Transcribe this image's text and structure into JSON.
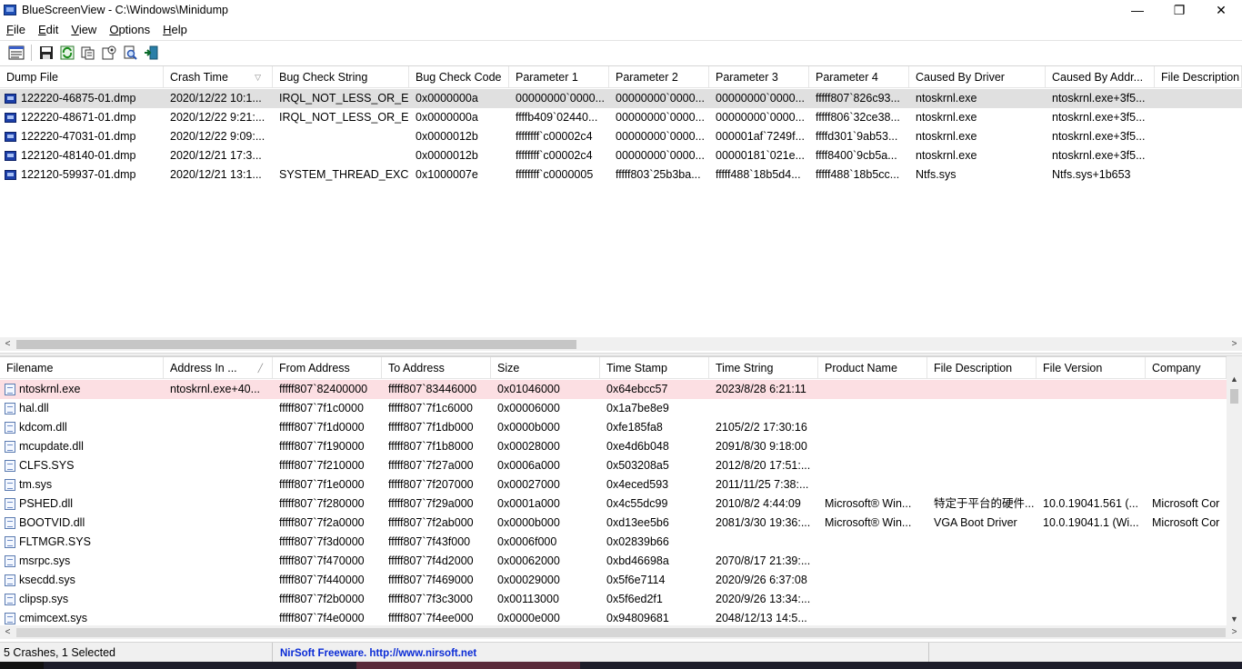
{
  "window": {
    "title": "BlueScreenView  -  C:\\Windows\\Minidump",
    "controls": {
      "minimize": "—",
      "maximize": "❐",
      "close": "✕"
    }
  },
  "menu": [
    {
      "accel": "F",
      "rest": "ile"
    },
    {
      "accel": "E",
      "rest": "dit"
    },
    {
      "accel": "V",
      "rest": "iew"
    },
    {
      "accel": "O",
      "rest": "ptions"
    },
    {
      "accel": "H",
      "rest": "elp"
    }
  ],
  "toolbar": {
    "icons": [
      "properties-icon",
      "save-icon",
      "refresh-icon",
      "copy-icon",
      "advanced-options-icon",
      "find-icon",
      "exit-icon"
    ]
  },
  "top_table": {
    "columns": [
      "Dump File",
      "Crash Time",
      "Bug Check String",
      "Bug Check Code",
      "Parameter 1",
      "Parameter 2",
      "Parameter 3",
      "Parameter 4",
      "Caused By Driver",
      "Caused By Addr...",
      "File Description"
    ],
    "sort_column": "Crash Time",
    "sort_glyph": "▽",
    "rows": [
      [
        "122220-46875-01.dmp",
        "2020/12/22 10:1...",
        "IRQL_NOT_LESS_OR_E...",
        "0x0000000a",
        "00000000`0000...",
        "00000000`0000...",
        "00000000`0000...",
        "fffff807`826c93...",
        "ntoskrnl.exe",
        "ntoskrnl.exe+3f5...",
        ""
      ],
      [
        "122220-48671-01.dmp",
        "2020/12/22 9:21:...",
        "IRQL_NOT_LESS_OR_E...",
        "0x0000000a",
        "ffffb409`02440...",
        "00000000`0000...",
        "00000000`0000...",
        "fffff806`32ce38...",
        "ntoskrnl.exe",
        "ntoskrnl.exe+3f5...",
        ""
      ],
      [
        "122220-47031-01.dmp",
        "2020/12/22 9:09:...",
        "",
        "0x0000012b",
        "ffffffff`c00002c4",
        "00000000`0000...",
        "000001af`7249f...",
        "ffffd301`9ab53...",
        "ntoskrnl.exe",
        "ntoskrnl.exe+3f5...",
        ""
      ],
      [
        "122120-48140-01.dmp",
        "2020/12/21 17:3...",
        "",
        "0x0000012b",
        "ffffffff`c00002c4",
        "00000000`0000...",
        "00000181`021e...",
        "ffff8400`9cb5a...",
        "ntoskrnl.exe",
        "ntoskrnl.exe+3f5...",
        ""
      ],
      [
        "122120-59937-01.dmp",
        "2020/12/21 13:1...",
        "SYSTEM_THREAD_EXC...",
        "0x1000007e",
        "ffffffff`c0000005",
        "fffff803`25b3ba...",
        "fffff488`18b5d4...",
        "fffff488`18b5cc...",
        "Ntfs.sys",
        "Ntfs.sys+1b653",
        ""
      ]
    ]
  },
  "bottom_table": {
    "columns": [
      "Filename",
      "Address In ...",
      "From Address",
      "To Address",
      "Size",
      "Time Stamp",
      "Time String",
      "Product Name",
      "File Description",
      "File Version",
      "Company"
    ],
    "sort_column": "Address In ...",
    "sort_glyph": "╱",
    "rows": [
      [
        "ntoskrnl.exe",
        "ntoskrnl.exe+40...",
        "fffff807`82400000",
        "fffff807`83446000",
        "0x01046000",
        "0x64ebcc57",
        "2023/8/28 6:21:11",
        "",
        "",
        "",
        ""
      ],
      [
        "hal.dll",
        "",
        "fffff807`7f1c0000",
        "fffff807`7f1c6000",
        "0x00006000",
        "0x1a7be8e9",
        "",
        "",
        "",
        "",
        ""
      ],
      [
        "kdcom.dll",
        "",
        "fffff807`7f1d0000",
        "fffff807`7f1db000",
        "0x0000b000",
        "0xfe185fa8",
        "2105/2/2 17:30:16",
        "",
        "",
        "",
        ""
      ],
      [
        "mcupdate.dll",
        "",
        "fffff807`7f190000",
        "fffff807`7f1b8000",
        "0x00028000",
        "0xe4d6b048",
        "2091/8/30 9:18:00",
        "",
        "",
        "",
        ""
      ],
      [
        "CLFS.SYS",
        "",
        "fffff807`7f210000",
        "fffff807`7f27a000",
        "0x0006a000",
        "0x503208a5",
        "2012/8/20 17:51:...",
        "",
        "",
        "",
        ""
      ],
      [
        "tm.sys",
        "",
        "fffff807`7f1e0000",
        "fffff807`7f207000",
        "0x00027000",
        "0x4eced593",
        "2011/11/25 7:38:...",
        "",
        "",
        "",
        ""
      ],
      [
        "PSHED.dll",
        "",
        "fffff807`7f280000",
        "fffff807`7f29a000",
        "0x0001a000",
        "0x4c55dc99",
        "2010/8/2 4:44:09",
        "Microsoft® Win...",
        "特定于平台的硬件...",
        "10.0.19041.561 (...",
        "Microsoft Cor"
      ],
      [
        "BOOTVID.dll",
        "",
        "fffff807`7f2a0000",
        "fffff807`7f2ab000",
        "0x0000b000",
        "0xd13ee5b6",
        "2081/3/30 19:36:...",
        "Microsoft® Win...",
        "VGA Boot Driver",
        "10.0.19041.1 (Wi...",
        "Microsoft Cor"
      ],
      [
        "FLTMGR.SYS",
        "",
        "fffff807`7f3d0000",
        "fffff807`7f43f000",
        "0x0006f000",
        "0x02839b66",
        "",
        "",
        "",
        "",
        ""
      ],
      [
        "msrpc.sys",
        "",
        "fffff807`7f470000",
        "fffff807`7f4d2000",
        "0x00062000",
        "0xbd46698a",
        "2070/8/17 21:39:...",
        "",
        "",
        "",
        ""
      ],
      [
        "ksecdd.sys",
        "",
        "fffff807`7f440000",
        "fffff807`7f469000",
        "0x00029000",
        "0x5f6e7114",
        "2020/9/26 6:37:08",
        "",
        "",
        "",
        ""
      ],
      [
        "clipsp.sys",
        "",
        "fffff807`7f2b0000",
        "fffff807`7f3c3000",
        "0x00113000",
        "0x5f6ed2f1",
        "2020/9/26 13:34:...",
        "",
        "",
        "",
        ""
      ],
      [
        "cmimcext.sys",
        "",
        "fffff807`7f4e0000",
        "fffff807`7f4ee000",
        "0x0000e000",
        "0x94809681",
        "2048/12/13 14:5...",
        "",
        "",
        "",
        ""
      ]
    ]
  },
  "status": {
    "summary": "5 Crashes, 1 Selected",
    "link": "NirSoft Freeware.  http://www.nirsoft.net"
  },
  "scroll_arrows": {
    "left": "<",
    "right": ">",
    "up": "▲",
    "down": "▼"
  },
  "colors": {
    "selected_row": "#e0e0e0",
    "highlight_row": "#fcdfe3",
    "link": "#0a2bd6"
  }
}
